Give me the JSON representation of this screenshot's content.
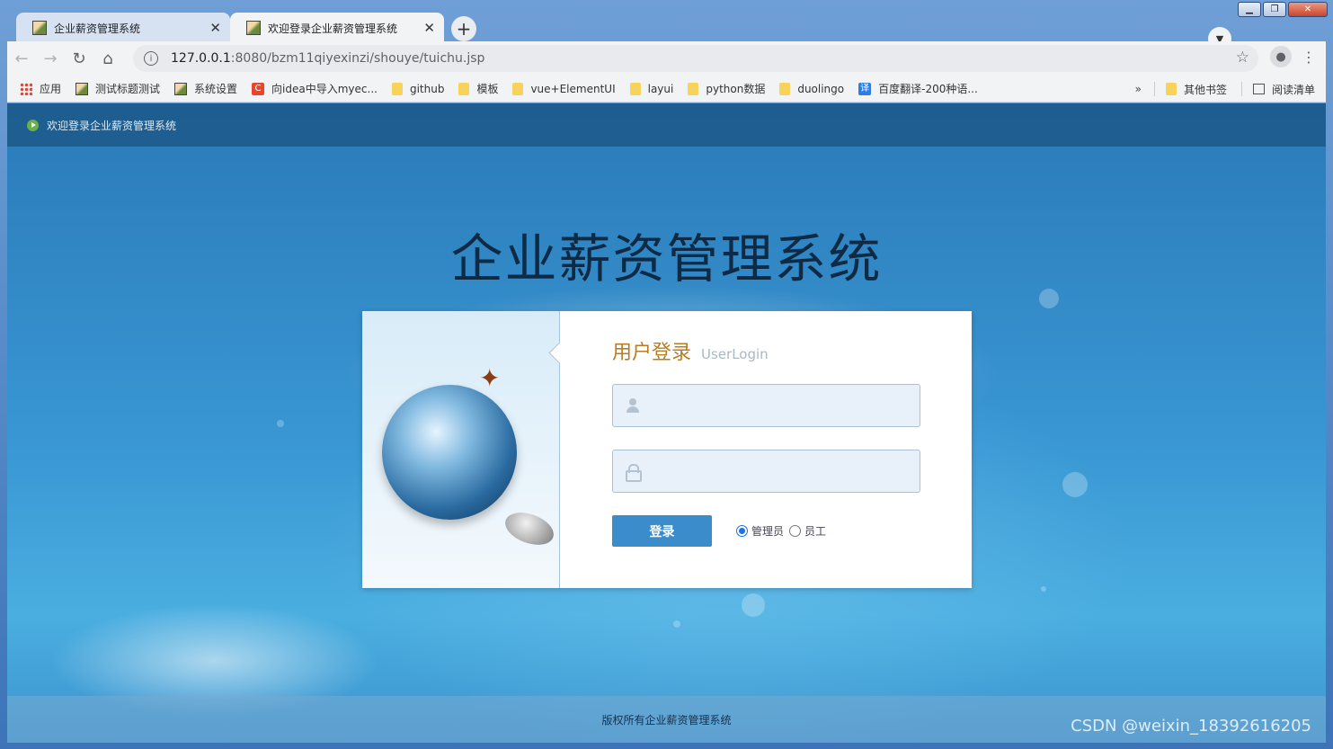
{
  "browser": {
    "tabs": [
      {
        "title": "企业薪资管理系统",
        "active": false
      },
      {
        "title": "欢迎登录企业薪资管理系统",
        "active": true
      }
    ],
    "url_host": "127.0.0.1",
    "url_path": ":8080/bzm11qiyexinzi/shouye/tuichu.jsp",
    "bookmarks": [
      {
        "label": "应用",
        "icon": "apps-icon"
      },
      {
        "label": "测试标题测试",
        "icon": "page-icon"
      },
      {
        "label": "系统设置",
        "icon": "page-icon"
      },
      {
        "label": "向idea中导入myec...",
        "icon": "csdn-icon"
      },
      {
        "label": "github",
        "icon": "folder-icon"
      },
      {
        "label": "模板",
        "icon": "folder-icon"
      },
      {
        "label": "vue+ElementUI",
        "icon": "folder-icon"
      },
      {
        "label": "layui",
        "icon": "folder-icon"
      },
      {
        "label": "python数据",
        "icon": "folder-icon"
      },
      {
        "label": "duolingo",
        "icon": "folder-icon"
      },
      {
        "label": "百度翻译-200种语...",
        "icon": "translate-icon"
      }
    ],
    "bookmarks_overflow": "»",
    "other_bookmarks": "其他书签",
    "reading_list": "阅读清单"
  },
  "page": {
    "topbar_text": "欢迎登录企业薪资管理系统",
    "system_title": "企业薪资管理系统",
    "login": {
      "heading": "用户登录",
      "heading_en": "UserLogin",
      "username_value": "",
      "password_value": "",
      "submit_label": "登录",
      "roles": [
        {
          "label": "管理员",
          "checked": true
        },
        {
          "label": "员工",
          "checked": false
        }
      ]
    },
    "footer_text": "版权所有企业薪资管理系统",
    "watermark": "CSDN @weixin_18392616205"
  },
  "icons": {
    "back": "arrow-left-icon",
    "forward": "arrow-right-icon",
    "reload": "reload-icon",
    "home": "home-icon",
    "info": "info-icon",
    "star": "star-icon",
    "profile": "profile-icon",
    "menu": "kebab-menu-icon"
  },
  "colors": {
    "login_button": "#3a8ccb",
    "heading": "#b87d22",
    "page_background": "#3a98d4"
  }
}
